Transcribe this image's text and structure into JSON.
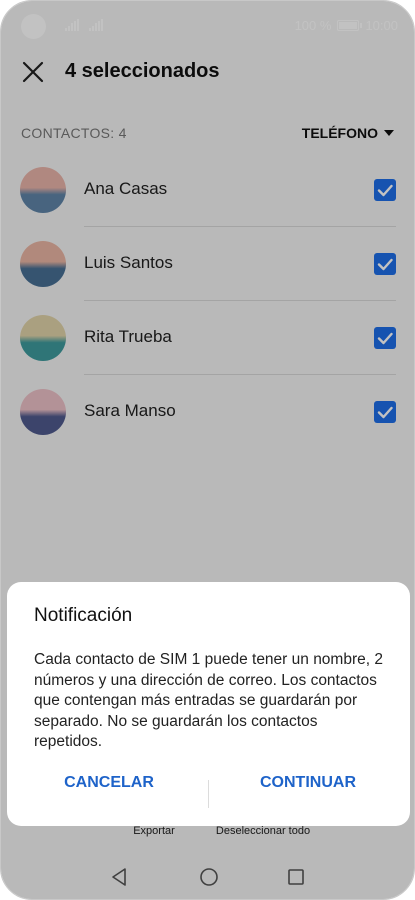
{
  "status_bar": {
    "battery_percent": "100 %",
    "time": "10:00",
    "battery_level": 1.0
  },
  "header": {
    "title": "4 seleccionados"
  },
  "list_header": {
    "count_label": "CONTACTOS: 4",
    "account_selector": "TELÉFONO"
  },
  "contacts": [
    {
      "name": "Ana Casas",
      "checked": true,
      "avatar_colors": [
        "#e8b3a9",
        "#5f84a8"
      ]
    },
    {
      "name": "Luis Santos",
      "checked": true,
      "avatar_colors": [
        "#e9b5a3",
        "#476f94"
      ]
    },
    {
      "name": "Rita Trueba",
      "checked": true,
      "avatar_colors": [
        "#e0d3a9",
        "#3f9a9d"
      ]
    },
    {
      "name": "Sara Manso",
      "checked": true,
      "avatar_colors": [
        "#ecc0c7",
        "#4f5a8d"
      ]
    }
  ],
  "bottom_bar": {
    "export_label": "Exportar",
    "deselect_all_label": "Deseleccionar todo"
  },
  "dialog": {
    "title": "Notificación",
    "body": "Cada contacto de SIM 1 puede tener un nombre, 2 números y una dirección de correo. Los contactos que contengan más entradas se guardarán por separado. No se guardarán los contactos repetidos.",
    "cancel_label": "CANCELAR",
    "continue_label": "CONTINUAR"
  },
  "colors": {
    "accent": "#1e6ee8",
    "dialog_button": "#1e63c9"
  }
}
